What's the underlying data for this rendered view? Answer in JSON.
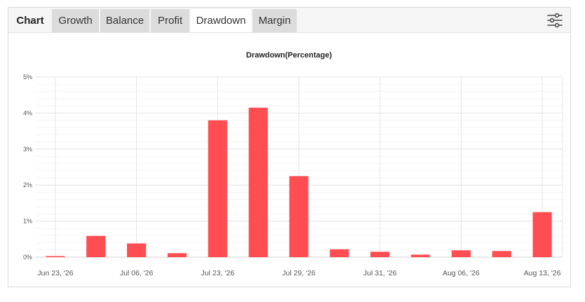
{
  "tabs": [
    {
      "label": "Chart",
      "state": "bold"
    },
    {
      "label": "Growth",
      "state": "inactive"
    },
    {
      "label": "Balance",
      "state": "inactive"
    },
    {
      "label": "Profit",
      "state": "inactive"
    },
    {
      "label": "Drawdown",
      "state": "active"
    },
    {
      "label": "Margin",
      "state": "inactive"
    }
  ],
  "settings_icon": "sliders-icon",
  "colors": {
    "bar": "#ff4d52",
    "grid": "#e6e6e6",
    "text": "#555555",
    "title": "#222222"
  },
  "chart_data": {
    "type": "bar",
    "title": "Drawdown(Percentage)",
    "xlabel": "",
    "ylabel": "",
    "ylim": [
      0,
      5
    ],
    "y_ticks": [
      "0%",
      "1%",
      "2%",
      "3%",
      "4%",
      "5%"
    ],
    "x_tick_labels": [
      "Jun 23, '26",
      "Jul 06, '26",
      "Jul 23, '26",
      "Jul 29, '26",
      "Jul 31, '26",
      "Aug 06, '26",
      "Aug 13, '26"
    ],
    "values": [
      0.03,
      0.59,
      0.38,
      0.11,
      3.8,
      4.15,
      2.25,
      0.22,
      0.15,
      0.07,
      0.19,
      0.17,
      1.25
    ],
    "grid": true,
    "legend": "none"
  }
}
